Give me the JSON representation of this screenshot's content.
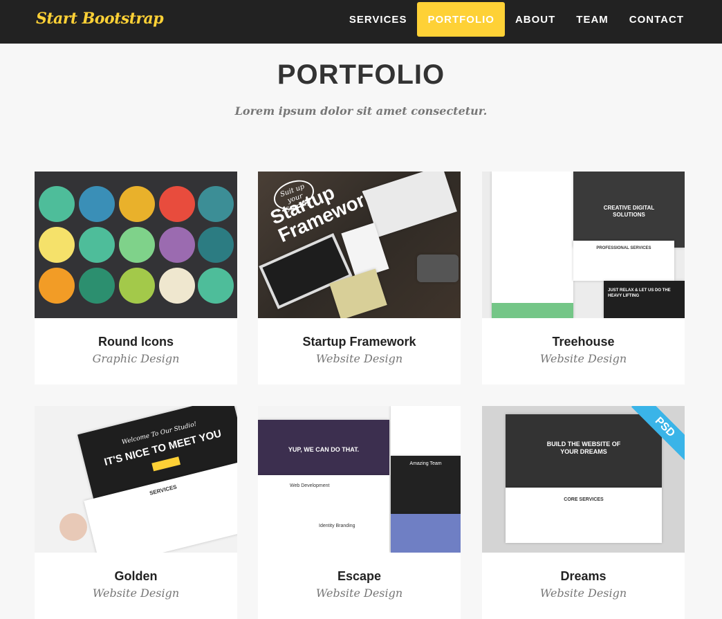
{
  "navbar": {
    "brand": "Start Bootstrap",
    "items": [
      {
        "label": "SERVICES",
        "active": false
      },
      {
        "label": "PORTFOLIO",
        "active": true
      },
      {
        "label": "ABOUT",
        "active": false
      },
      {
        "label": "TEAM",
        "active": false
      },
      {
        "label": "CONTACT",
        "active": false
      }
    ]
  },
  "section": {
    "heading": "PORTFOLIO",
    "subheading": "Lorem ipsum dolor sit amet consectetur."
  },
  "portfolio": {
    "items": [
      {
        "title": "Round Icons",
        "category": "Graphic Design"
      },
      {
        "title": "Startup Framework",
        "category": "Website Design"
      },
      {
        "title": "Treehouse",
        "category": "Website Design"
      },
      {
        "title": "Golden",
        "category": "Website Design"
      },
      {
        "title": "Escape",
        "category": "Website Design"
      },
      {
        "title": "Dreams",
        "category": "Website Design"
      }
    ]
  },
  "thumbnails": {
    "startup_badge": "Suit up your Startup",
    "startup_text": "Startup Framework",
    "treehouse_hero": "CREATIVE DIGITAL SOLUTIONS",
    "treehouse_services": "PROFESSIONAL SERVICES",
    "treehouse_relax": "JUST RELAX & LET US DO THE HEAVY LIFTING",
    "golden_welcome": "Welcome To Our Studio!",
    "golden_hero": "IT'S NICE TO MEET YOU",
    "golden_services": "SERVICES",
    "escape_hero": "YUP, WE CAN DO THAT.",
    "escape_team": "Amazing Team",
    "escape_dev": "Web Development",
    "escape_branding": "Identity Branding",
    "dreams_hero": "BUILD THE WEBSITE OF YOUR DREAMS",
    "dreams_core": "CORE SERVICES",
    "dreams_ribbon": "PSD"
  },
  "colors": {
    "accent": "#fed136",
    "navbar_bg": "#222222",
    "page_bg": "#f7f7f7",
    "ribbon": "#3ab4e8"
  }
}
